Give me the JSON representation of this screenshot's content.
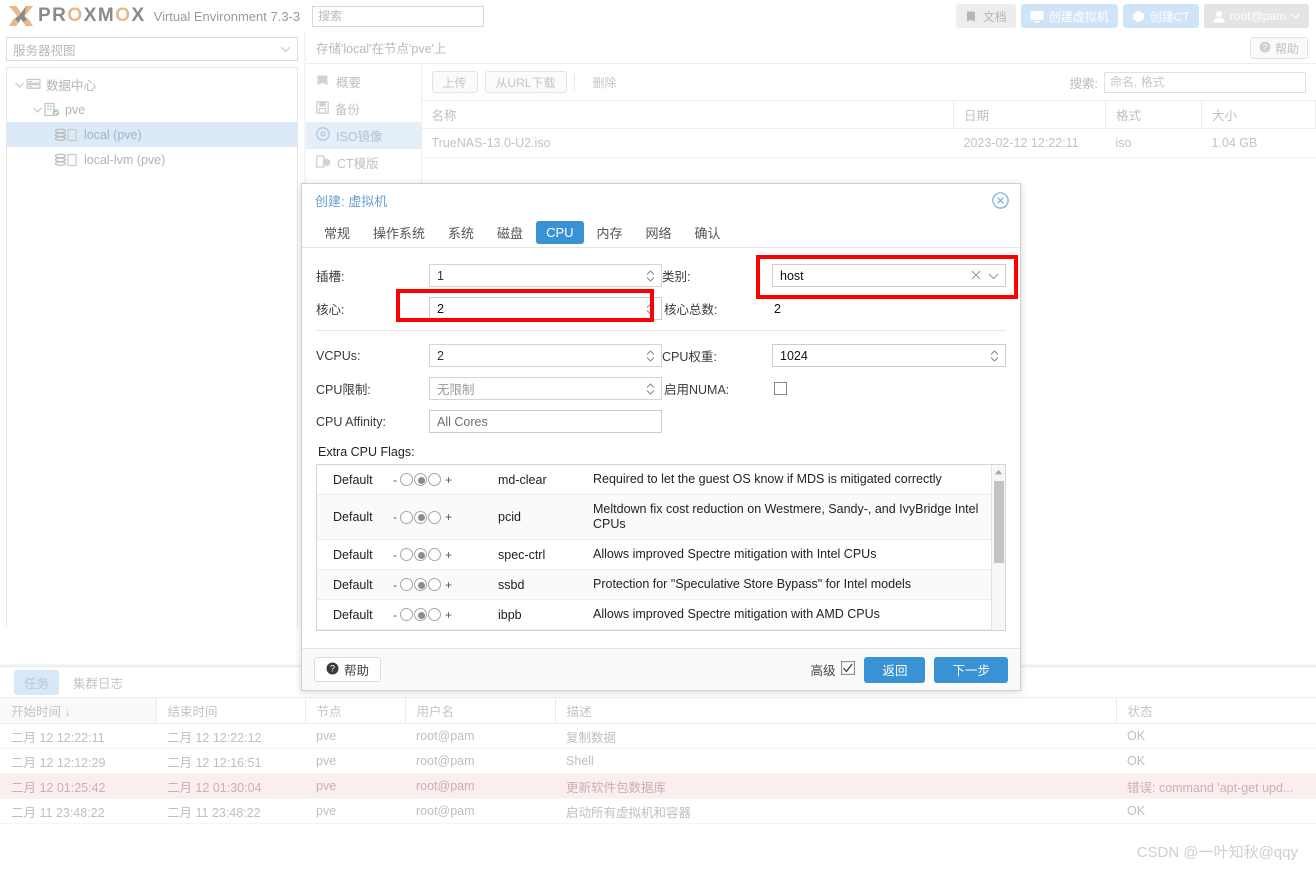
{
  "header": {
    "brand": "PROXMOX",
    "brand_sub": "Virtual Environment 7.3-3",
    "search_placeholder": "搜索",
    "buttons": [
      {
        "label": "文档",
        "icon": "book-icon"
      },
      {
        "label": "创建虚拟机",
        "icon": "monitor-icon"
      },
      {
        "label": "创建CT",
        "icon": "box-icon"
      },
      {
        "label": "root@pam",
        "icon": "user-icon"
      }
    ]
  },
  "sidebar": {
    "view_selector": "服务器视图",
    "tree": [
      {
        "label": "数据中心",
        "icon": "datacenter-icon",
        "depth": 0,
        "selected": false
      },
      {
        "label": "pve",
        "icon": "node-icon",
        "depth": 1,
        "selected": false
      },
      {
        "label": "local (pve)",
        "icon": "storage-icon",
        "depth": 2,
        "selected": true
      },
      {
        "label": "local-lvm (pve)",
        "icon": "storage-icon",
        "depth": 2,
        "selected": false
      }
    ]
  },
  "content": {
    "title": "存储'local'在节点'pve'上",
    "help_label": "帮助",
    "nav": [
      {
        "label": "概要",
        "icon": "summary-icon",
        "selected": false
      },
      {
        "label": "备份",
        "icon": "backup-icon",
        "selected": false
      },
      {
        "label": "ISO镜像",
        "icon": "iso-icon",
        "selected": true
      },
      {
        "label": "CT模版",
        "icon": "ct-template-icon",
        "selected": false
      }
    ],
    "toolbar": {
      "upload": "上传",
      "download_url": "从URL下载",
      "remove": "删除",
      "search_label": "搜索:",
      "search_placeholder": "命名, 格式"
    },
    "table": {
      "columns": [
        "名称",
        "日期",
        "格式",
        "大小"
      ],
      "rows": [
        {
          "name": "TrueNAS-13.0-U2.iso",
          "date": "2023-02-12 12:22:11",
          "format": "iso",
          "size": "1.04 GB"
        }
      ]
    }
  },
  "dialog": {
    "title": "创建: 虚拟机",
    "close_icon": "close-circle-icon",
    "tabs": [
      {
        "label": "常规",
        "selected": false
      },
      {
        "label": "操作系统",
        "selected": false
      },
      {
        "label": "系统",
        "selected": false
      },
      {
        "label": "磁盘",
        "selected": false
      },
      {
        "label": "CPU",
        "selected": true
      },
      {
        "label": "内存",
        "selected": false
      },
      {
        "label": "网络",
        "selected": false
      },
      {
        "label": "确认",
        "selected": false
      }
    ],
    "fields": {
      "sockets_label": "插槽:",
      "sockets_value": "1",
      "cores_label": "核心:",
      "cores_value": "2",
      "type_label": "类别:",
      "type_value": "host",
      "total_cores_label": "核心总数:",
      "total_cores_value": "2",
      "vcpus_label": "VCPUs:",
      "vcpus_value": "2",
      "cpu_weight_label": "CPU权重:",
      "cpu_weight_value": "1024",
      "cpu_limit_label": "CPU限制:",
      "cpu_limit_value": "无限制",
      "numa_label": "启用NUMA:",
      "numa_checked": false,
      "affinity_label": "CPU Affinity:",
      "affinity_value": "All Cores"
    },
    "flags": {
      "label": "Extra CPU Flags:",
      "rows": [
        {
          "state": "Default",
          "name": "md-clear",
          "desc": "Required to let the guest OS know if MDS is mitigated correctly"
        },
        {
          "state": "Default",
          "name": "pcid",
          "desc": "Meltdown fix cost reduction on Westmere, Sandy-, and IvyBridge Intel CPUs"
        },
        {
          "state": "Default",
          "name": "spec-ctrl",
          "desc": "Allows improved Spectre mitigation with Intel CPUs"
        },
        {
          "state": "Default",
          "name": "ssbd",
          "desc": "Protection for \"Speculative Store Bypass\" for Intel models"
        },
        {
          "state": "Default",
          "name": "ibpb",
          "desc": "Allows improved Spectre mitigation with AMD CPUs"
        }
      ],
      "minus": "-",
      "plus": "+"
    },
    "footer": {
      "help": "帮助",
      "advanced": "高级",
      "advanced_checked": true,
      "back": "返回",
      "next": "下一步"
    }
  },
  "tasks": {
    "tabs": [
      {
        "label": "任务",
        "selected": true
      },
      {
        "label": "集群日志",
        "selected": false
      }
    ],
    "columns": [
      "开始时间 ↓",
      "结束时间",
      "节点",
      "用户名",
      "描述",
      "状态"
    ],
    "rows": [
      {
        "start": "二月 12 12:22:11",
        "end": "二月 12 12:22:12",
        "node": "pve",
        "user": "root@pam",
        "desc": "复制数据",
        "status": "OK",
        "error": false
      },
      {
        "start": "二月 12 12:12:29",
        "end": "二月 12 12:16:51",
        "node": "pve",
        "user": "root@pam",
        "desc": "Shell",
        "status": "OK",
        "error": false
      },
      {
        "start": "二月 12 01:25:42",
        "end": "二月 12 01:30:04",
        "node": "pve",
        "user": "root@pam",
        "desc": "更新软件包数据库",
        "status": "错误: command 'apt-get upd...",
        "error": true
      },
      {
        "start": "二月 11 23:48:22",
        "end": "二月 11 23:48:22",
        "node": "pve",
        "user": "root@pam",
        "desc": "启动所有虚拟机和容器",
        "status": "OK",
        "error": false
      }
    ]
  },
  "watermark": "CSDN @一叶知秋@qqy",
  "colors": {
    "accent_blue": "#3892d4",
    "annotation_red": "#FF0000",
    "logo_orange": "#e8b88a"
  }
}
